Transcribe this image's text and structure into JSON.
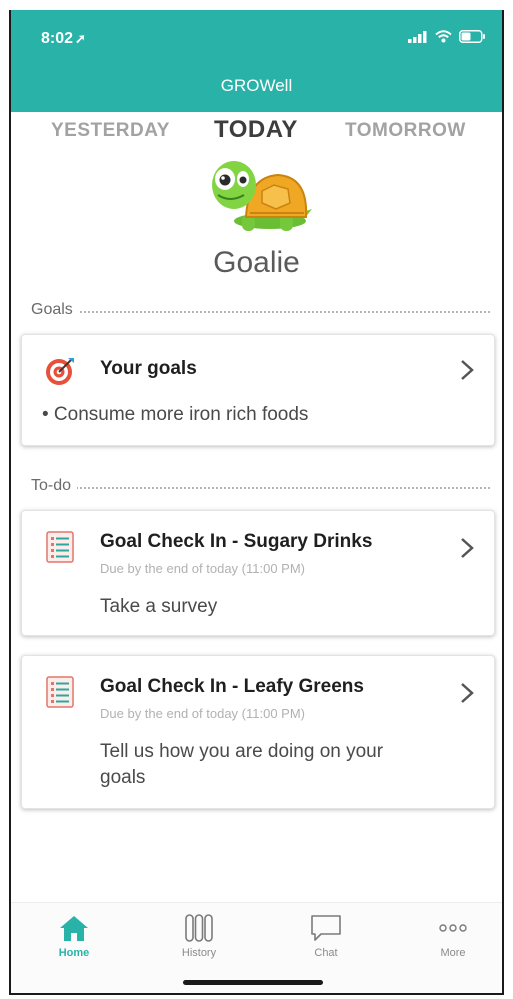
{
  "status_bar": {
    "time": "8:02",
    "location_glyph": "➚"
  },
  "app": {
    "title": "GROWell"
  },
  "day_tabs": [
    "YESTERDAY",
    "TODAY",
    "TOMORROW"
  ],
  "mascot": {
    "name": "Goalie",
    "icon": "turtle-icon"
  },
  "goals_section": {
    "label": "Goals",
    "card": {
      "title": "Your goals",
      "icon": "target-icon",
      "items": [
        "• Consume more iron rich foods"
      ]
    }
  },
  "todo_section": {
    "label": "To-do",
    "items": [
      {
        "title": "Goal Check In - Sugary Drinks",
        "due": "Due by the end of today (11:00 PM)",
        "body": "Take a survey",
        "icon": "checklist-icon"
      },
      {
        "title": "Goal Check In - Leafy Greens",
        "due": "Due by the end of today (11:00 PM)",
        "body": "Tell us how you are doing on your goals",
        "icon": "checklist-icon"
      }
    ]
  },
  "tab_bar": [
    {
      "label": "Home",
      "icon": "home-icon",
      "active": true
    },
    {
      "label": "History",
      "icon": "history-icon",
      "active": false
    },
    {
      "label": "Chat",
      "icon": "chat-icon",
      "active": false
    },
    {
      "label": "More",
      "icon": "more-icon",
      "active": false
    }
  ],
  "colors": {
    "accent": "#29b2a8",
    "target": "#e8503a",
    "mascot_shell": "#f0a824",
    "mascot_body": "#7ed03f"
  }
}
